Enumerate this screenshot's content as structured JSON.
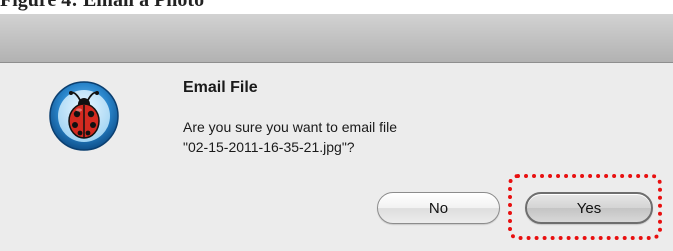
{
  "caption": {
    "fragment": "Figure 4: Email a Photo"
  },
  "dialog": {
    "title": "Email File",
    "message_line1": "Are you sure you want to email file",
    "message_line2": "\"02-15-2011-16-35-21.jpg\"?",
    "icon": "ladybug-app-icon",
    "buttons": {
      "no_label": "No",
      "yes_label": "Yes"
    }
  },
  "annotation": {
    "highlight_target": "yes-button",
    "color": "#e81010"
  },
  "colors": {
    "titlebar": "#c2c2c2",
    "dialog_background": "#ececec",
    "icon_ring": "#2a7fc4",
    "ladybug_red": "#d42a20"
  }
}
